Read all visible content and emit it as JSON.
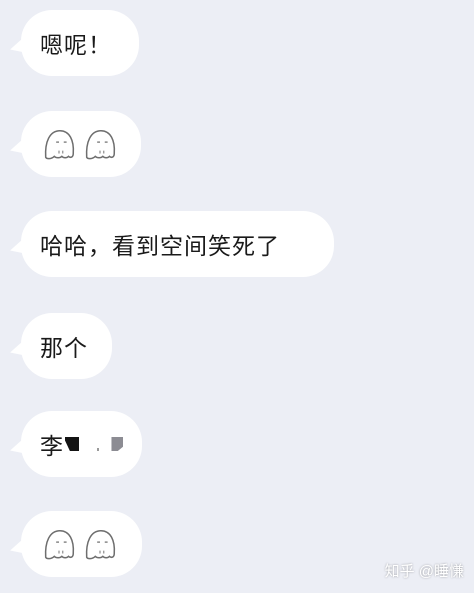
{
  "messages": [
    {
      "type": "text",
      "text": "嗯呢！"
    },
    {
      "type": "sticker",
      "stickers": [
        "ghost-icon",
        "ghost-icon"
      ]
    },
    {
      "type": "text",
      "text": "哈哈，看到空间笑死了"
    },
    {
      "type": "text",
      "text": "那个"
    },
    {
      "type": "text-redacted",
      "text": "李"
    },
    {
      "type": "sticker",
      "stickers": [
        "ghost-icon",
        "ghost-icon"
      ]
    }
  ],
  "watermark": {
    "text": "知乎 @睡慊"
  },
  "colors": {
    "background": "#eceef5",
    "bubble": "#ffffff",
    "text": "#1a1a1a"
  }
}
